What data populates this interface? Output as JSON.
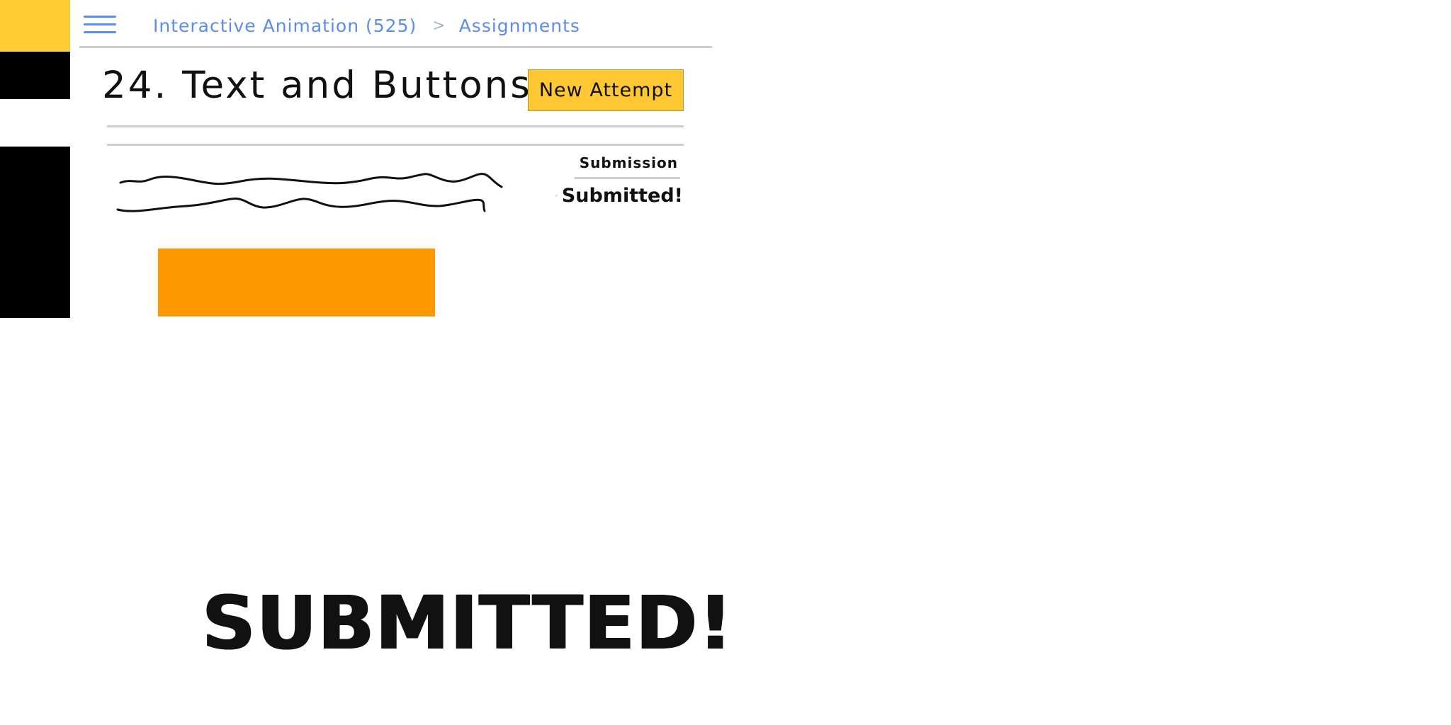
{
  "breadcrumb": {
    "course": "Interactive Animation (525)",
    "separator": ">",
    "section": "Assignments"
  },
  "assignment": {
    "title": "24. Text and Buttons",
    "new_attempt_label": "New Attempt"
  },
  "submission": {
    "label": "Submission",
    "status": "Submitted!",
    "status_icon": "checkmark-icon"
  },
  "stamp": {
    "text": "SUBMITTED!"
  },
  "colors": {
    "accent_yellow": "#ffcc33",
    "link_blue": "#5b8def",
    "content_orange": "#ff9900",
    "nav_black": "#000000",
    "rule_gray": "#cfcfcf"
  }
}
